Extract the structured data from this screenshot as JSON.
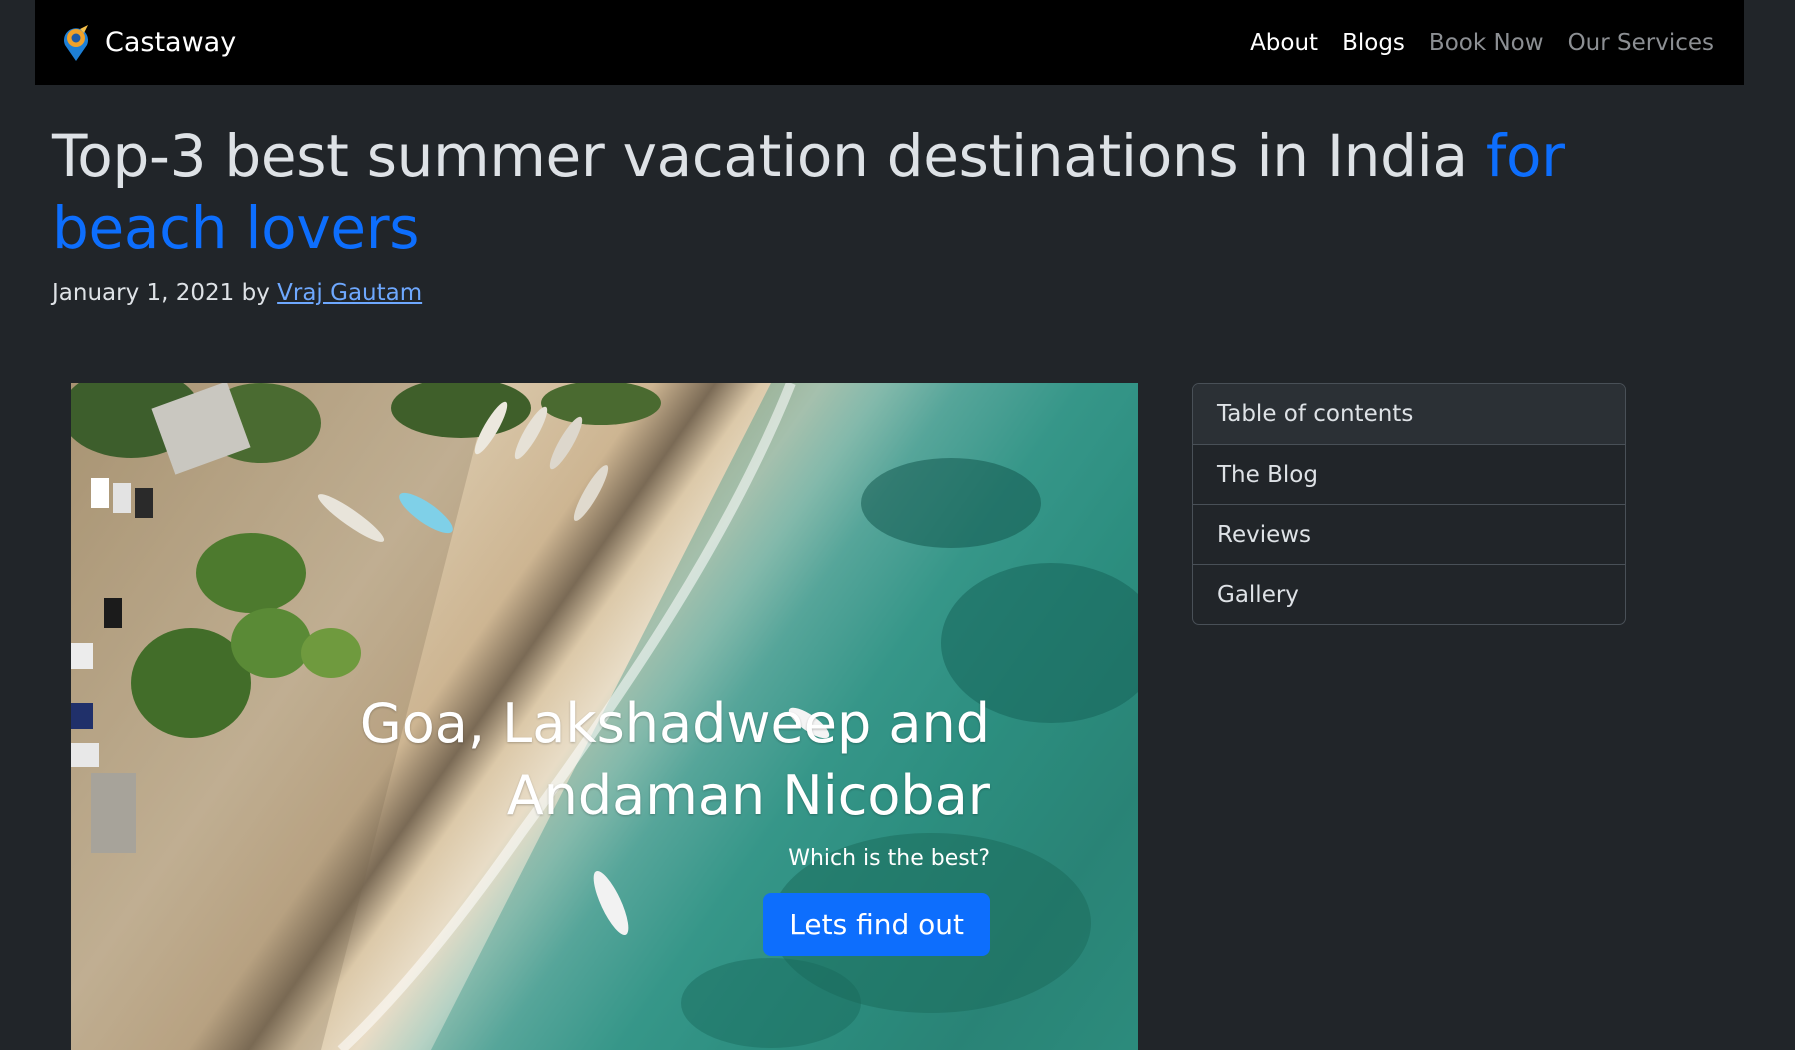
{
  "navbar": {
    "brand": "Castaway",
    "links": [
      {
        "label": "About",
        "state": "active"
      },
      {
        "label": "Blogs",
        "state": "active"
      },
      {
        "label": "Book Now",
        "state": "muted"
      },
      {
        "label": "Our Services",
        "state": "muted"
      }
    ]
  },
  "header": {
    "title_main": "Top-3 best summer vacation destinations in India ",
    "title_accent": "for beach lovers",
    "byline_prefix": "January 1, 2021 by ",
    "author": "Vraj Gautam"
  },
  "hero": {
    "heading": "Goa, Lakshadweep and Andaman Nicobar",
    "subheading": "Which is the best?",
    "button_label": "Lets find out"
  },
  "toc": {
    "items": [
      "Table of contents",
      "The Blog",
      "Reviews",
      "Gallery"
    ]
  },
  "colors": {
    "background": "#212529",
    "navbar": "#000000",
    "accent": "#0d6efd",
    "link": "#6ea8fe"
  }
}
